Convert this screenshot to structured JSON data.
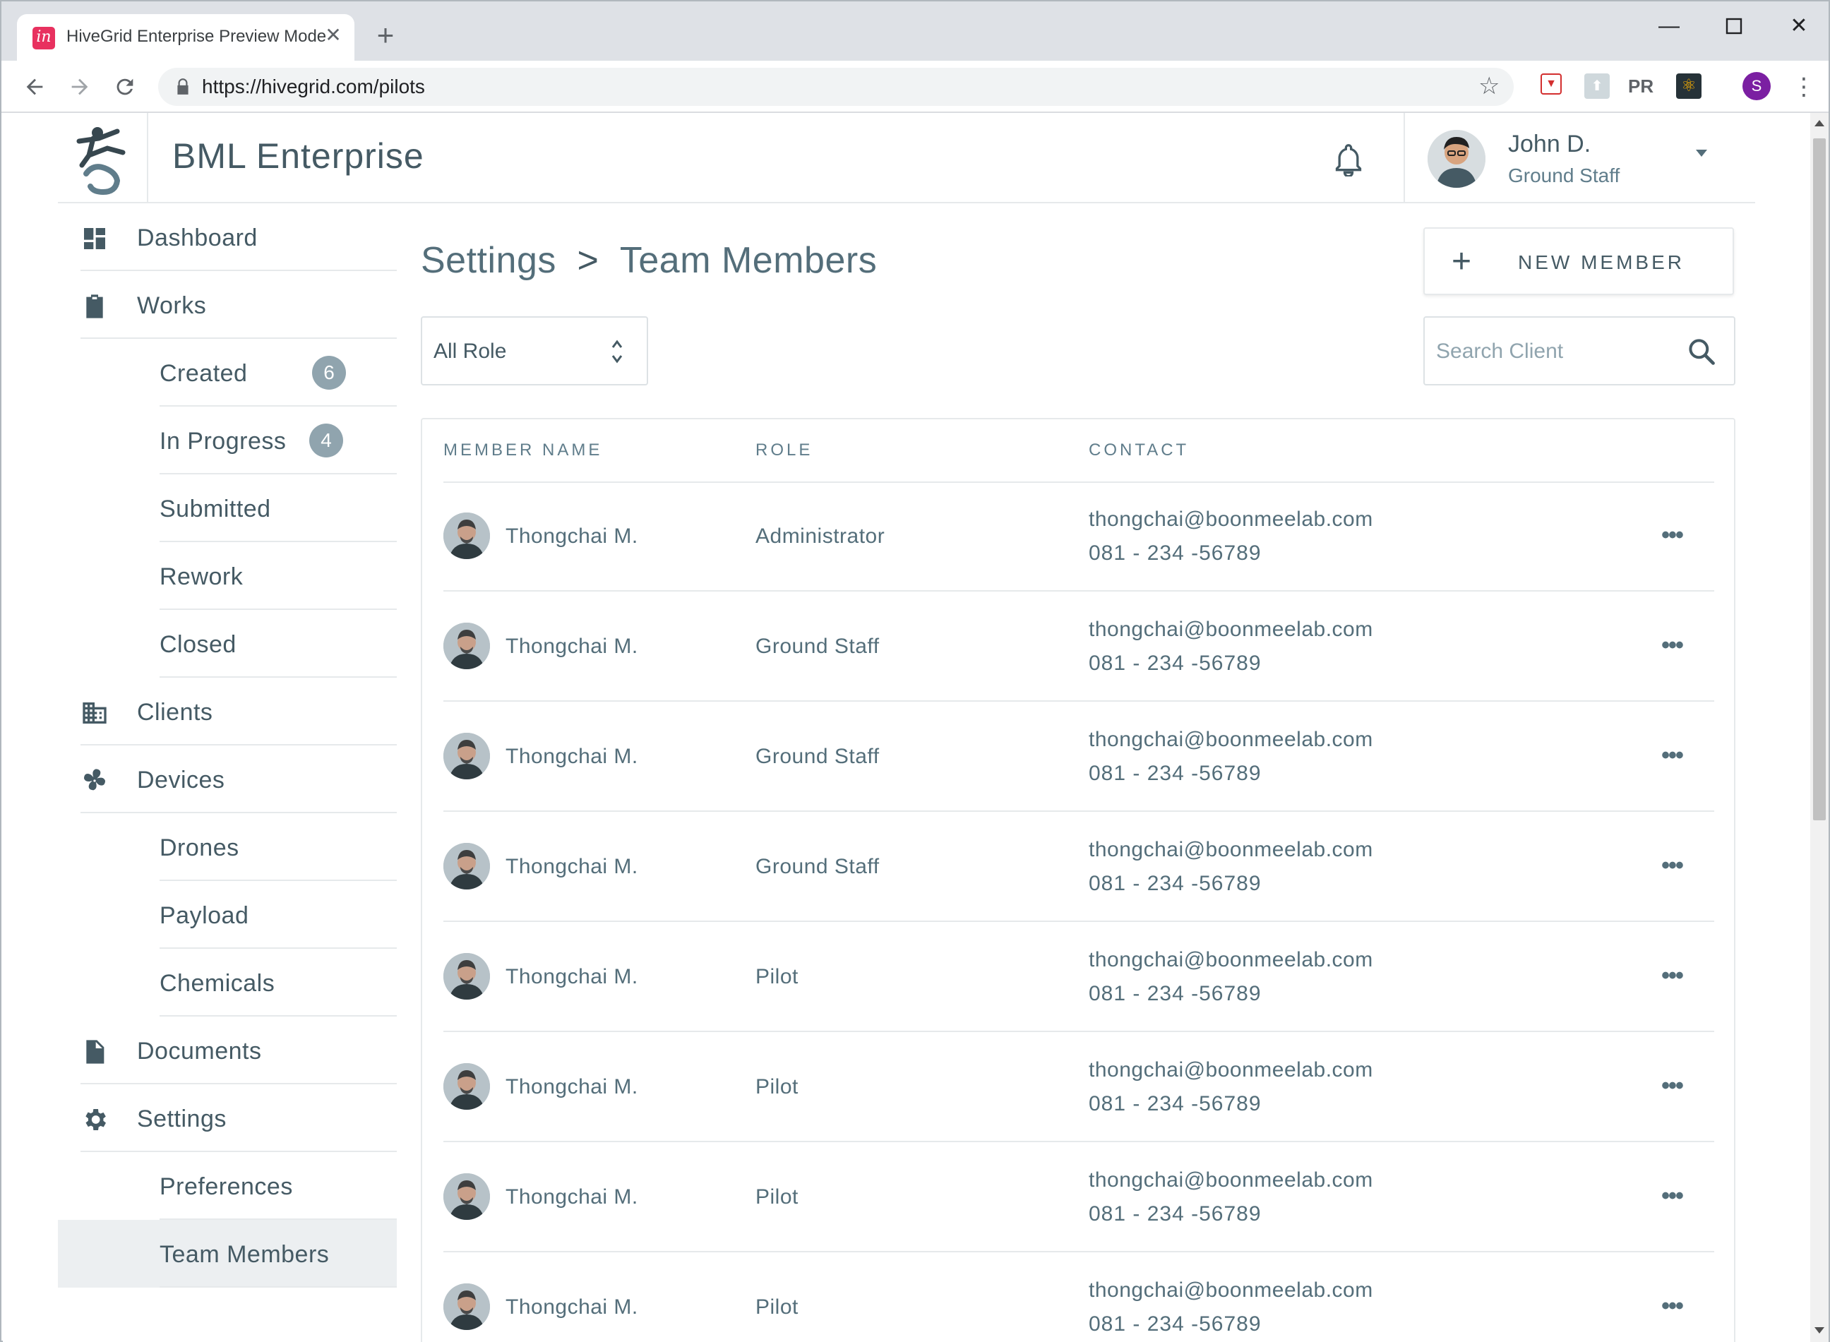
{
  "browser": {
    "tab_title": "HiveGrid Enterprise Preview Mode",
    "tab_favicon_text": "in",
    "url": "https://hivegrid.com/pilots",
    "profile_initial": "S",
    "extensions": [
      "pocket-icon",
      "pdf-icon",
      "pr-icon",
      "react-icon"
    ]
  },
  "app": {
    "title": "BML Enterprise",
    "user": {
      "name": "John D.",
      "role": "Ground Staff"
    }
  },
  "sidebar": {
    "items": [
      {
        "label": "Dashboard",
        "icon": "dashboard-icon"
      },
      {
        "label": "Works",
        "icon": "clipboard-icon"
      },
      {
        "label": "Created",
        "badge": "6"
      },
      {
        "label": "In Progress",
        "badge": "4"
      },
      {
        "label": "Submitted"
      },
      {
        "label": "Rework"
      },
      {
        "label": "Closed"
      },
      {
        "label": "Clients",
        "icon": "building-icon"
      },
      {
        "label": "Devices",
        "icon": "fan-icon"
      },
      {
        "label": "Drones"
      },
      {
        "label": "Payload"
      },
      {
        "label": "Chemicals"
      },
      {
        "label": "Documents",
        "icon": "document-icon"
      },
      {
        "label": "Settings",
        "icon": "gear-icon"
      },
      {
        "label": "Preferences"
      },
      {
        "label": "Team Members",
        "active": true
      }
    ]
  },
  "main": {
    "breadcrumb": {
      "parent": "Settings",
      "separator": ">",
      "current": "Team Members"
    },
    "new_member_label": "NEW MEMBER",
    "role_filter": "All Role",
    "search_placeholder": "Search Client",
    "table": {
      "headers": {
        "name": "MEMBER NAME",
        "role": "ROLE",
        "contact": "CONTACT"
      },
      "rows": [
        {
          "name": "Thongchai M.",
          "role": "Administrator",
          "email": "thongchai@boonmeelab.com",
          "phone": "081 - 234 -56789"
        },
        {
          "name": "Thongchai M.",
          "role": "Ground Staff",
          "email": "thongchai@boonmeelab.com",
          "phone": "081 - 234 -56789"
        },
        {
          "name": "Thongchai M.",
          "role": "Ground Staff",
          "email": "thongchai@boonmeelab.com",
          "phone": "081 - 234 -56789"
        },
        {
          "name": "Thongchai M.",
          "role": "Ground Staff",
          "email": "thongchai@boonmeelab.com",
          "phone": "081 - 234 -56789"
        },
        {
          "name": "Thongchai M.",
          "role": "Pilot",
          "email": "thongchai@boonmeelab.com",
          "phone": "081 - 234 -56789"
        },
        {
          "name": "Thongchai M.",
          "role": "Pilot",
          "email": "thongchai@boonmeelab.com",
          "phone": "081 - 234 -56789"
        },
        {
          "name": "Thongchai M.",
          "role": "Pilot",
          "email": "thongchai@boonmeelab.com",
          "phone": "081 - 234 -56789"
        },
        {
          "name": "Thongchai M.",
          "role": "Pilot",
          "email": "thongchai@boonmeelab.com",
          "phone": "081 - 234 -56789"
        }
      ]
    }
  },
  "colors": {
    "accent": "#455a64",
    "badge": "#90a4ae",
    "active_bg": "#eceff1",
    "favicon": "#e8315f",
    "profile": "#7b1fa2"
  }
}
